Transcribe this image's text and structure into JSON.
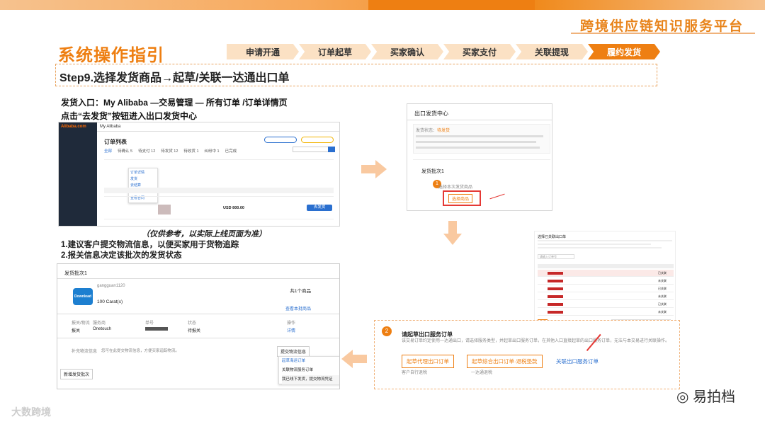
{
  "brand": "跨境供应链知识服务平台",
  "title": "系统操作指引",
  "steps": [
    {
      "label": "申请开通",
      "active": false
    },
    {
      "label": "订单起草",
      "active": false
    },
    {
      "label": "买家确认",
      "active": false
    },
    {
      "label": "买家支付",
      "active": false
    },
    {
      "label": "关联提现",
      "active": false
    },
    {
      "label": "履约发货",
      "active": true
    }
  ],
  "step_heading": "Step9.选择发货商品→起草/关联一达通出口单",
  "intro": {
    "line1": "发货入口：My Alibaba —交易管理 — 所有订单 /订单详情页",
    "line2": "点击“去发货”按钮进入出口发货中心"
  },
  "caption": "（仅供参考，以实际上线页面为准）",
  "notes": {
    "line1": "1.建议客户提交物流信息，以便买家用于货物追踪",
    "line2": "2.报关信息决定该批次的发货状态"
  },
  "screen1": {
    "logo": "Alibaba.com",
    "nav": "My Alibaba",
    "heading": "订单列表",
    "tabs": [
      "全部",
      "待确认 5",
      "待支付 12",
      "待发货 12",
      "待收货 1",
      "纠纷中 1",
      "已完成"
    ],
    "menu": [
      "订单详情",
      "发货",
      "去结算",
      "订单附件",
      "查看合同"
    ],
    "btn": "去发货",
    "amount": "USD 800.00"
  },
  "screen2": {
    "title": "出口发货中心",
    "status_label": "发货状态：",
    "status_value": "待发货",
    "batch": "发货批次1",
    "step_num": "1",
    "select_label": "选择本次发货商品",
    "select_btn": "选择商品"
  },
  "screen3": {
    "title": "选择已关联出口单",
    "filter": "请输入订单号",
    "rows": [
      "已关联",
      "未关联",
      "已关联",
      "未关联",
      "已关联",
      "未关联"
    ]
  },
  "screen4": {
    "step_num": "2",
    "title": "请起草出口服务订单",
    "desc": "该交易订单约定使用一达通出口，请选择服务类型，并起草出口服务订单，在其他入口直接起草的出口服务订单，无法与本交易进行关联操作。",
    "btn1": "起草代理出口订单",
    "btn2": "起草综合出口订单·退税垫款",
    "link": "关联出口服务订单",
    "sub1": "客户自行退税",
    "sub2": "一达通退税"
  },
  "screen5": {
    "batch": "发货批次1",
    "account": "gangguan1120",
    "total": "共1个商品",
    "icon_text": "Download",
    "qty": "100 Carat(s)",
    "view": "查看本批商品",
    "headers": [
      "报关/物流",
      "服务商",
      "单号",
      "状态",
      "操作"
    ],
    "row1": [
      "报关",
      "Onetouch",
      "",
      "待报关",
      "详情"
    ],
    "logistics_label": "补充物流信息",
    "logistics_hint": "您可在此提交物流信息，方便买家追踪物流。",
    "submit_btn": "提交物流信息",
    "dropdown": [
      "起草海运订单",
      "关联物流服务订单",
      "我已线下发货，提交物流凭证"
    ],
    "add_btn": "新增发货批次"
  },
  "footer": {
    "wechat": "易拍档",
    "watermark": "大数跨境"
  }
}
